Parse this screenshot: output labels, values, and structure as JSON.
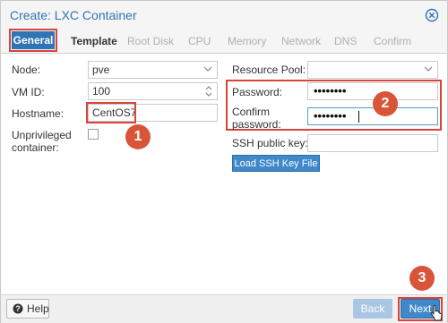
{
  "window": {
    "title": "Create: LXC Container"
  },
  "tabs": [
    {
      "label": "General",
      "active": true
    },
    {
      "label": "Template",
      "active": false
    },
    {
      "label": "Root Disk",
      "active": false
    },
    {
      "label": "CPU",
      "active": false
    },
    {
      "label": "Memory",
      "active": false
    },
    {
      "label": "Network",
      "active": false
    },
    {
      "label": "DNS",
      "active": false
    },
    {
      "label": "Confirm",
      "active": false
    }
  ],
  "left": {
    "node_label": "Node:",
    "node_value": "pve",
    "vmid_label": "VM ID:",
    "vmid_value": "100",
    "hostname_label": "Hostname:",
    "hostname_value": "CentOS7",
    "unpriv_label_line1": "Unprivileged",
    "unpriv_label_line2": "container:",
    "unpriv_checked": false
  },
  "right": {
    "pool_label": "Resource Pool:",
    "pool_value": "",
    "password_label": "Password:",
    "password_value": "••••••••",
    "confirm_label_line1": "Confirm",
    "confirm_label_line2": "password:",
    "confirm_value": "••••••••",
    "ssh_label": "SSH public key:",
    "ssh_value": "",
    "load_ssh_button": "Load SSH Key File"
  },
  "annotations": [
    "1",
    "2",
    "3"
  ],
  "footer": {
    "help_label": "Help",
    "back_label": "Back",
    "next_label": "Next"
  },
  "colors": {
    "accent": "#2f74b5",
    "highlight": "#d9443a",
    "badge": "#d9553a",
    "button_blue": "#3f88c9"
  },
  "icons": {
    "close": "close-circle-icon",
    "dropdown": "chevron-down-icon",
    "spinner": "spinner-updown-icon",
    "help": "question-circle-icon",
    "pointer": "hand-pointer-icon"
  }
}
